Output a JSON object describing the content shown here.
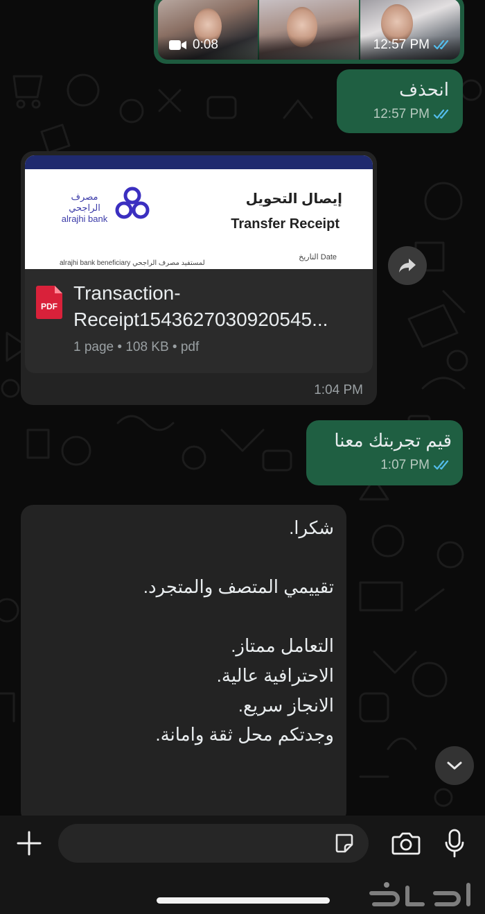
{
  "video_message": {
    "duration": "0:08",
    "time": "12:57 PM",
    "status": "read"
  },
  "messages": [
    {
      "text": "انحذف",
      "time": "12:57 PM",
      "status": "read"
    },
    {
      "text": "قيم تجربتك معنا",
      "time": "1:07 PM",
      "status": "read"
    }
  ],
  "receipt": {
    "preview_bank_name_ar": "مصرف الراجحي",
    "preview_bank_name_en": "alrajhi bank",
    "preview_title_ar": "إيصال التحويل",
    "preview_title_en": "Transfer Receipt",
    "preview_date_label": "التاريخ Date",
    "preview_beneficiary": "alrajhi bank beneficiary لمستفيد مصرف الراجحي",
    "file_name_line1": "Transaction-",
    "file_name_line2": "Receipt1543627030920545...",
    "file_details": "1 page • 108 KB • pdf",
    "time": "1:04 PM"
  },
  "incoming_review": {
    "text": "شكرا.\n\nتقييمي المتصف والمتجرد.\n\nالتعامل ممتاز.\nالاحترافية عالية.\nالانجاز سريع.\nوجدتكم محل ثقة وامانة."
  },
  "composer": {
    "placeholder": ""
  },
  "icons": {
    "forward": "forward-icon",
    "scroll_down": "chevron-down-icon",
    "attach": "plus-icon",
    "sticker": "sticker-icon",
    "camera": "camera-icon",
    "microphone": "microphone-icon"
  },
  "watermark_text": "حراج",
  "colors": {
    "outgoing_bubble": "#1f5f42",
    "incoming_bubble": "#232323",
    "read_ticks": "#53bdeb",
    "background": "#0b0b0b",
    "pdf_red": "#d9213a"
  }
}
